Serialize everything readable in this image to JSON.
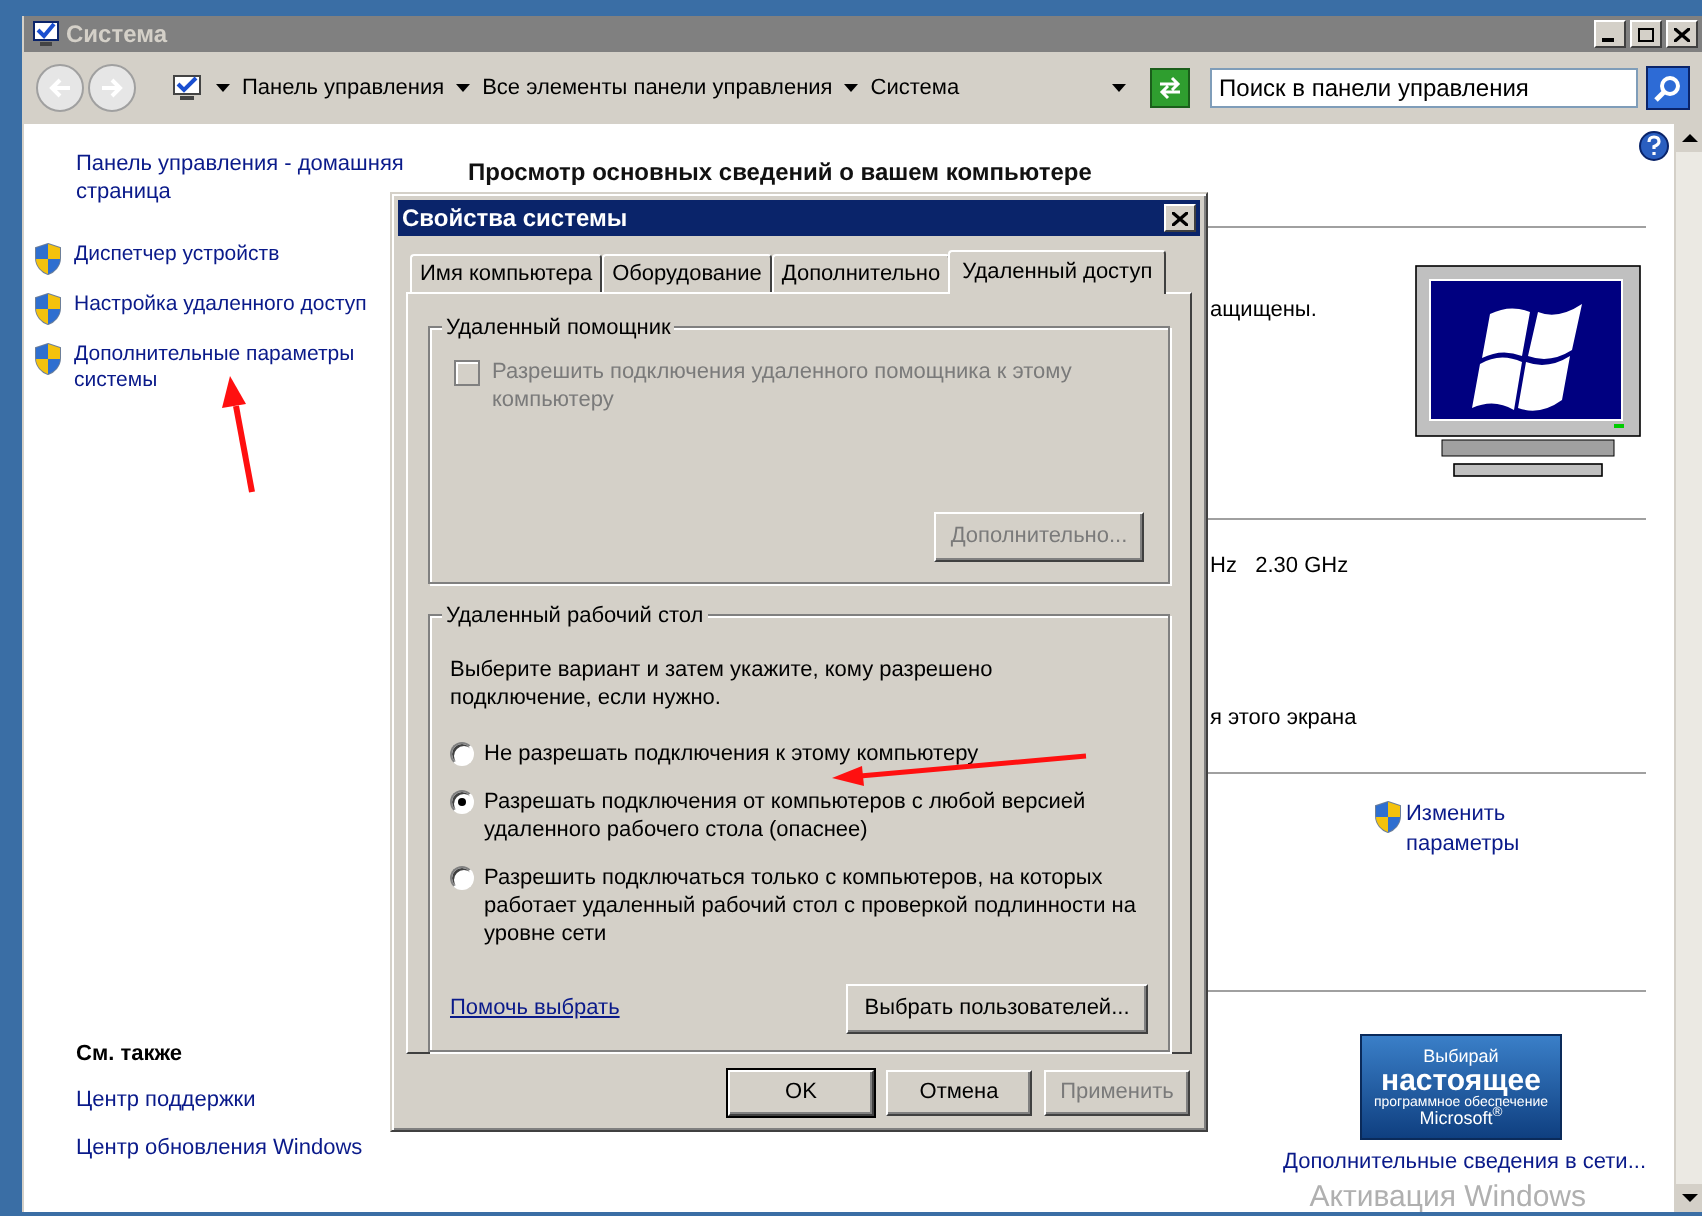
{
  "window": {
    "title": "Система"
  },
  "address_bar": {
    "breadcrumbs": [
      "Панель управления",
      "Все элементы панели управления",
      "Система"
    ]
  },
  "search": {
    "placeholder": "Поиск в панели управления"
  },
  "sidebar": {
    "home_link": "Панель управления - домашняя страница",
    "items": [
      {
        "label": "Диспетчер устройств"
      },
      {
        "label": "Настройка удаленного доступ"
      },
      {
        "label": "Дополнительные параметры системы"
      }
    ],
    "see_also": {
      "title": "См. также",
      "links": [
        "Центр поддержки",
        "Центр обновления Windows"
      ]
    }
  },
  "main": {
    "heading": "Просмотр основных сведений о вашем компьютере",
    "fragments": [
      "ащищены.",
      "Hz   2.30 GHz",
      "я этого экрана"
    ],
    "change_settings": "Изменить параметры",
    "genuine_badge": [
      "Выбирай",
      "настоящее",
      "программное обеспечение",
      "Microsoft$^{®}$"
    ],
    "more_info_link": "Дополнительные сведения в сети..."
  },
  "dialog": {
    "title": "Свойства системы",
    "tabs": [
      {
        "label": "Имя компьютера",
        "selected": false
      },
      {
        "label": "Оборудование",
        "selected": false
      },
      {
        "label": "Дополнительно",
        "selected": false
      },
      {
        "label": "Удаленный доступ",
        "selected": true
      }
    ],
    "assistance_group": {
      "title": "Удаленный помощник",
      "checkbox": {
        "label": "Разрешить подключения удаленного помощника к этому компьютеру",
        "checked": false,
        "disabled": true
      },
      "button": {
        "label": "Дополнительно...",
        "disabled": true
      }
    },
    "desktop_group": {
      "title": "Удаленный рабочий стол",
      "description": "Выберите вариант и затем укажите, кому разрешено подключение, если нужно.",
      "options": [
        {
          "label": "Не разрешать подключения к этому компьютеру",
          "selected": false
        },
        {
          "label": "Разрешать подключения от компьютеров с любой версией удаленного рабочего стола (опаснее)",
          "selected": true
        },
        {
          "label": "Разрешить подключаться только с компьютеров, на которых работает удаленный рабочий стол с проверкой подлинности на уровне сети",
          "selected": false
        }
      ],
      "help_link": "Помочь выбрать",
      "users_button": "Выбрать пользователей..."
    },
    "buttons": [
      {
        "label": "OK",
        "disabled": false
      },
      {
        "label": "Отмена",
        "disabled": false
      },
      {
        "label": "Применить",
        "disabled": true
      }
    ]
  },
  "activation_watermark": "Активация Windows"
}
